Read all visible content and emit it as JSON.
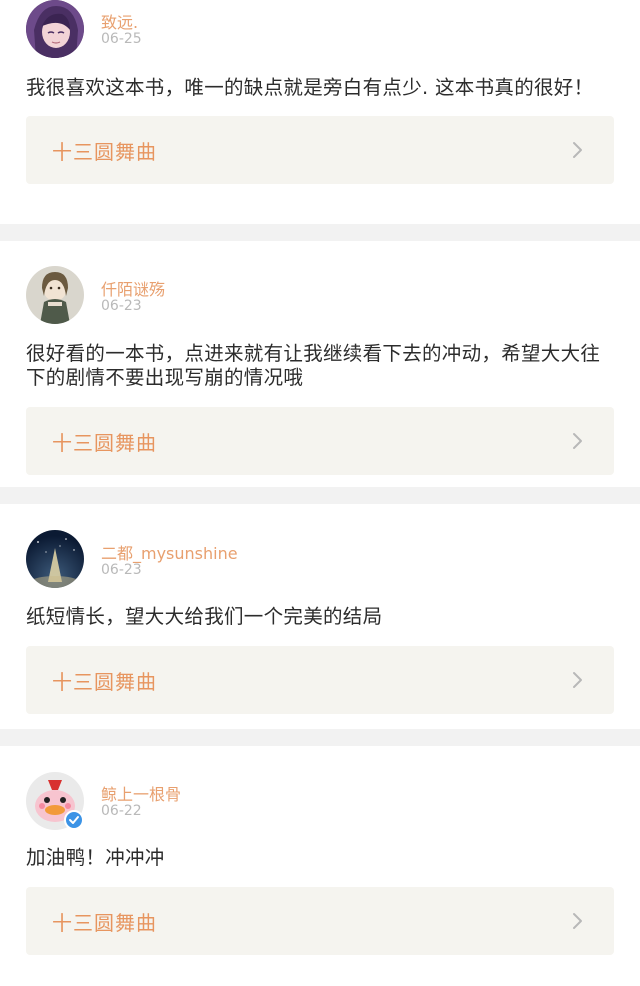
{
  "comments": [
    {
      "user": "致远.",
      "date": "06-25",
      "text": "我很喜欢这本书，唯一的缺点就是旁白有点少. 这本书真的很好！",
      "book": "十三圆舞曲",
      "avatar": "anime-girl-purple-avatar"
    },
    {
      "user": "仟陌谜殇",
      "date": "06-23",
      "text": "很好看的一本书，点进来就有让我继续看下去的冲动，希望大大往下的剧情不要出现写崩的情况哦",
      "book": "十三圆舞曲",
      "avatar": "doll-girl-avatar"
    },
    {
      "user": "二都_mysunshine",
      "date": "06-23",
      "text": "纸短情长，望大大给我们一个完美的结局",
      "book": "十三圆舞曲",
      "avatar": "night-sky-avatar"
    },
    {
      "user": "鲸上一根骨",
      "date": "06-22",
      "text": "加油鸭！冲冲冲",
      "book": "十三圆舞曲",
      "avatar": "pink-duck-avatar",
      "verified": true
    }
  ],
  "colors": {
    "username": "#e8a06f",
    "book_title": "#e7955f",
    "date": "#b9b9b9",
    "book_bg": "#f5f4ef",
    "verified": "#3b93e6"
  }
}
